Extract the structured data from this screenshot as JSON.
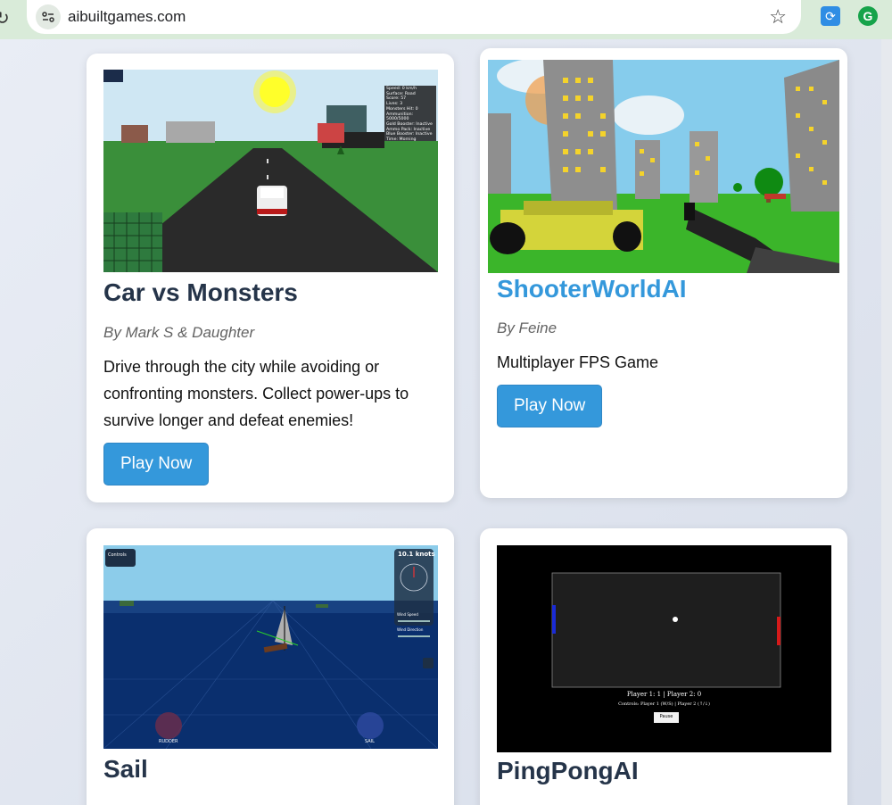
{
  "browser": {
    "url": "aibuiltgames.com",
    "reload_icon": "reload-icon",
    "site_info_icon": "site-info-icon",
    "bookmark_icon": "star-icon"
  },
  "games": [
    {
      "title": "Car vs Monsters",
      "author": "By Mark S & Daughter",
      "description": "Drive through the city while avoiding or confronting monsters. Collect power-ups to survive longer and defeat enemies!",
      "button": "Play Now"
    },
    {
      "title": "ShooterWorldAI",
      "author": "By Feine",
      "description": "Multiplayer FPS Game",
      "button": "Play Now"
    },
    {
      "title": "Sail",
      "author": "",
      "description": "",
      "button": ""
    },
    {
      "title": "PingPongAI",
      "author": "",
      "description": "",
      "button": ""
    }
  ],
  "thumbnails": {
    "car": {
      "hud": [
        "Speed: 0 km/h",
        "Surface: Road",
        "Score: 57",
        "Lives: 3",
        "Monsters Hit: 0",
        "Ammunition: 5000/5000",
        "Gold Booster: Inactive",
        "Ammo Pack: Inactive",
        "Blue Booster: Inactive",
        "Time: Morning"
      ]
    },
    "sail": {
      "controls": "Controls",
      "speed": "10.1 knots",
      "wind_speed": "Wind Speed",
      "wind_direction": "Wind Direction",
      "rudder": "RUDDER",
      "sail": "SAIL"
    },
    "pong": {
      "score": "Player 1: 1 | Player 2: 0",
      "controls": "Controls: Player 1 (W/S) | Player 2 (↑/↓)",
      "pause": "Pause"
    }
  }
}
